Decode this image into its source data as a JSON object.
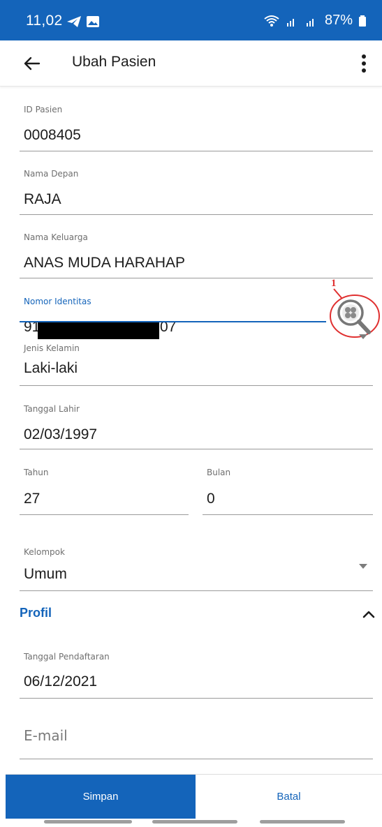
{
  "status_bar": {
    "time": "11,02",
    "battery": "87%"
  },
  "app_bar": {
    "title": "Ubah Pasien"
  },
  "fields": {
    "id_pasien": {
      "label": "ID Pasien",
      "value": "0008405"
    },
    "nama_depan": {
      "label": "Nama Depan",
      "value": "RAJA"
    },
    "nama_keluarga": {
      "label": "Nama Keluarga",
      "value": "ANAS MUDA HARAHAP"
    },
    "nomor_identitas": {
      "label": "Nomor Identitas",
      "value_prefix": "91",
      "value_suffix": "07"
    },
    "jenis_kelamin": {
      "label": "Jenis Kelamin",
      "value": "Laki-laki"
    },
    "tanggal_lahir": {
      "label": "Tanggal Lahir",
      "value": "02/03/1997"
    },
    "tahun": {
      "label": "Tahun",
      "value": "27"
    },
    "bulan": {
      "label": "Bulan",
      "value": "0"
    },
    "kelompok": {
      "label": "Kelompok",
      "value": "Umum"
    },
    "tanggal_pendaftaran": {
      "label": "Tanggal Pendaftaran",
      "value": "06/12/2021"
    },
    "email": {
      "placeholder": "E-mail"
    }
  },
  "section": {
    "profil": "Profil"
  },
  "annotation": {
    "marker": "1"
  },
  "buttons": {
    "simpan": "Simpan",
    "batal": "Batal"
  },
  "colors": {
    "primary": "#1464ba",
    "annotation": "#e03030"
  }
}
